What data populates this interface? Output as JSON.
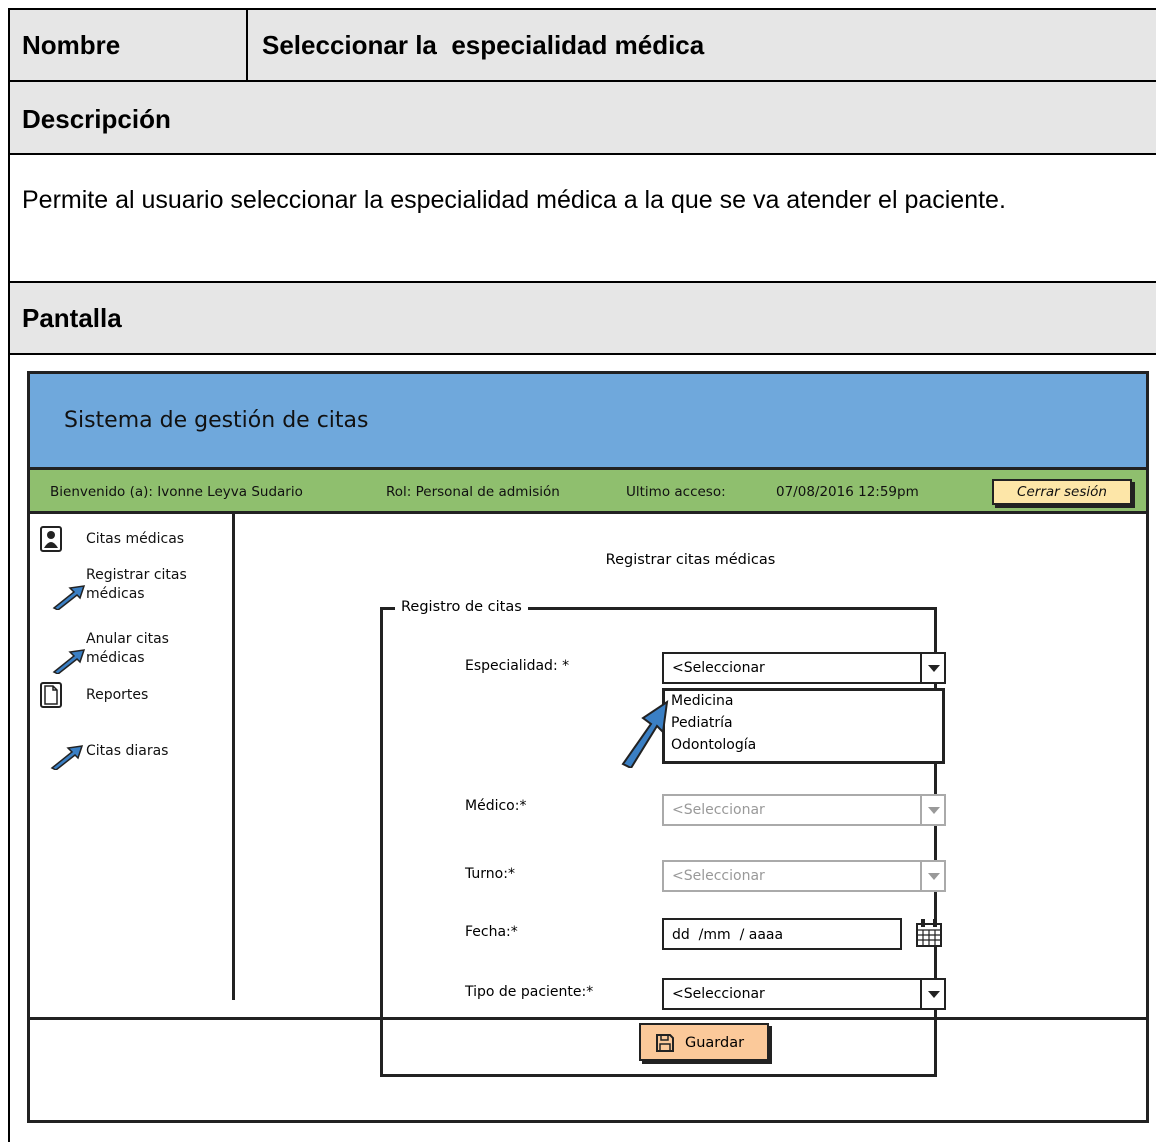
{
  "document": {
    "name_label": "Nombre",
    "name_value": "Seleccionar la  especialidad médica",
    "description_label": "Descripción",
    "description_text": "Permite al usuario seleccionar la especialidad médica a la que se va atender el paciente.",
    "screen_label": "Pantalla"
  },
  "mockup": {
    "app_title": "Sistema de gestión de citas",
    "status_bar": {
      "welcome": "Bienvenido (a): Ivonne Leyva Sudario",
      "role": "Rol: Personal de admisión",
      "last_access_label": "Ultimo acceso:",
      "last_access_value": "07/08/2016 12:59pm",
      "logout_label": "Cerrar sesión"
    },
    "sidebar": {
      "section_appointments": "Citas médicas",
      "register_line1": "Registrar citas",
      "register_line2": "médicas",
      "cancel_line1": "Anular citas",
      "cancel_line2": "médicas",
      "section_reports": "Reportes",
      "daily": "Citas diaras"
    },
    "form": {
      "page_title": "Registrar citas médicas",
      "legend": "Registro de citas",
      "specialty_label": "Especialidad: *",
      "specialty_value": "<Seleccionar",
      "specialty_options": [
        "Medicina",
        "Pediatría",
        "Odontología"
      ],
      "doctor_label": "Médico:*",
      "doctor_value": "<Seleccionar",
      "shift_label": "Turno:*",
      "shift_value": "<Seleccionar",
      "date_label": "Fecha:*",
      "date_placeholder": "dd  /mm  / aaaa",
      "patient_type_label": "Tipo de paciente:*",
      "patient_type_value": "<Seleccionar",
      "save_label": "Guardar"
    }
  },
  "colors": {
    "header_fill": "#e6e6e6",
    "title_bar": "#6fa8dc",
    "status_bar": "#8fbf6e",
    "logout_button": "#fde6a8",
    "save_button": "#fbc99a",
    "arrow": "#3a7fc4"
  },
  "icons": [
    "user-icon",
    "document-icon",
    "arrow-icon",
    "calendar-icon",
    "save-icon",
    "chevron-down-icon"
  ]
}
